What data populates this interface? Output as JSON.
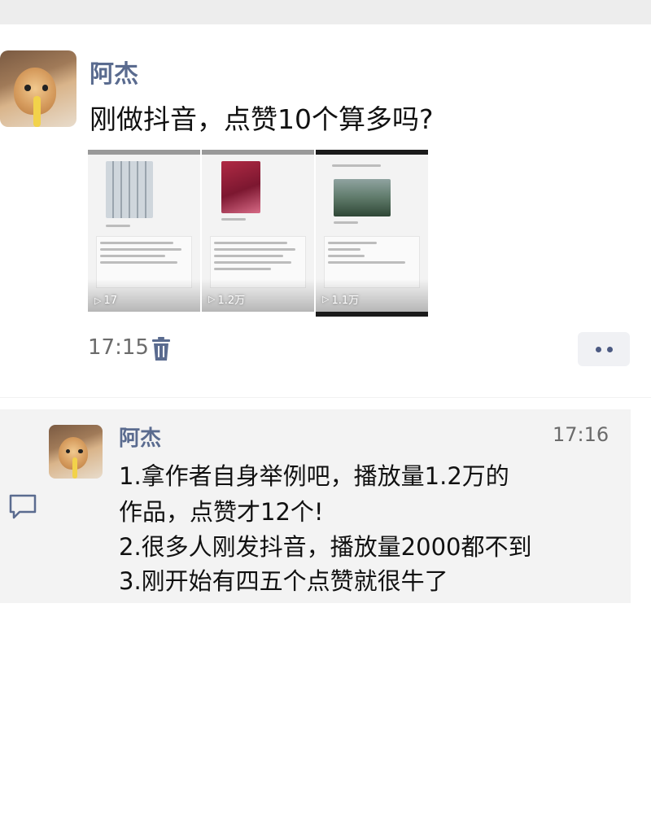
{
  "post": {
    "author": "阿杰",
    "text": "刚做抖音，点赞10个算多吗?",
    "thumbnails": [
      {
        "play_count": "17",
        "style": "light"
      },
      {
        "play_count": "1.2万",
        "style": "light"
      },
      {
        "play_count": "1.1万",
        "style": "dark"
      }
    ],
    "time": "17:15",
    "delete_icon": "trash-icon",
    "more_icon": "more-dots-icon"
  },
  "comment": {
    "author": "阿杰",
    "time": "17:16",
    "icon": "comment-bubble-icon",
    "lines": [
      "1.拿作者自身举例吧，播放量1.2万的",
      "作品，点赞才12个!",
      "2.很多人刚发抖音，播放量2000都不到",
      "3.刚开始有四五个点赞就很牛了"
    ]
  },
  "colors": {
    "name_blue": "#5a6b8f",
    "comment_bg": "#f3f3f3",
    "top_bar": "#ededed"
  }
}
